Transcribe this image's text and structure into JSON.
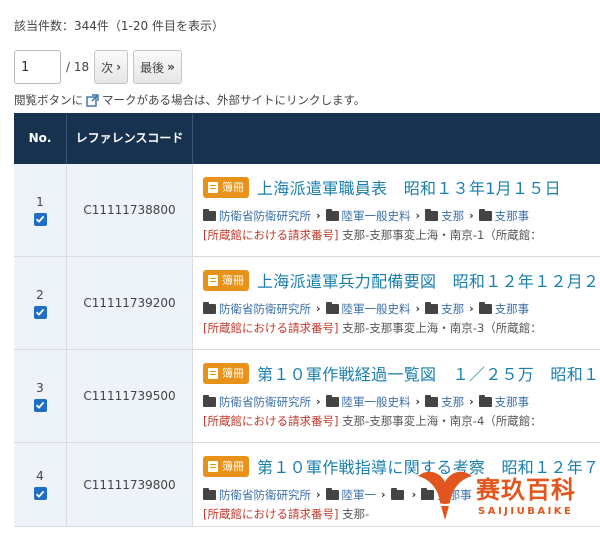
{
  "summary": {
    "count_text": "該当件数：344件（1-20 件目を表示）"
  },
  "pager": {
    "current_page": "1",
    "total_pages": "/ 18",
    "next_label": "次",
    "last_label": "最後"
  },
  "notice": {
    "prefix": "閲覧ボタンに",
    "suffix": "マークがある場合は、外部サイトにリンクします。"
  },
  "table": {
    "headers": {
      "no": "No.",
      "ref": "レファレンスコード",
      "title": ""
    },
    "badge_label": "簿冊",
    "call_label": "[所蔵館における請求番号]",
    "rows": [
      {
        "no": "1",
        "ref": "C11111738800",
        "title": "上海派遣軍職員表　昭和１３年1月１５日",
        "path": [
          "防衛省防衛研究所",
          "陸軍一般史料",
          "支那",
          "支那事"
        ],
        "call": "支那-支那事変上海・南京-1（所蔵館："
      },
      {
        "no": "2",
        "ref": "C11111739200",
        "title": "上海派遣軍兵力配備要図　昭和１２年１２月２",
        "path": [
          "防衛省防衛研究所",
          "陸軍一般史料",
          "支那",
          "支那事"
        ],
        "call": "支那-支那事変上海・南京-3（所蔵館："
      },
      {
        "no": "3",
        "ref": "C11111739500",
        "title": "第１０軍作戦経過一覧図　１／２５万　昭和１",
        "path": [
          "防衛省防衛研究所",
          "陸軍一般史料",
          "支那",
          "支那事"
        ],
        "call": "支那-支那事変上海・南京-4（所蔵館："
      },
      {
        "no": "4",
        "ref": "C11111739800",
        "title": "第１０軍作戦指導に関する考察　昭和１２年７",
        "path": [
          "防衛省防衛研究所",
          "陸軍一",
          "",
          "支那事"
        ],
        "call": "支那-"
      }
    ]
  },
  "watermark": {
    "brand": "赛玖百科",
    "sub": "SAIJIUBAIKE"
  },
  "colors": {
    "header_bg": "#16324f",
    "accent": "#1a7fae",
    "badge": "#e8921a",
    "checkbox": "#1f6ec4",
    "logo": "#e2561d"
  }
}
